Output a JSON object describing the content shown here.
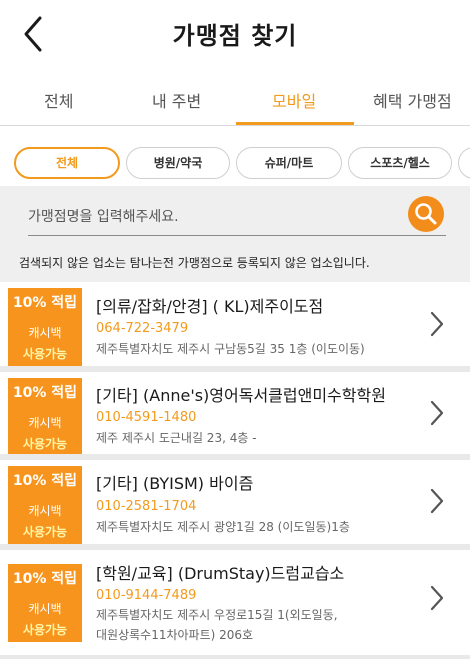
{
  "header": {
    "title": "가맹점 찾기",
    "back_icon": "chevron-left-icon"
  },
  "tabs": [
    {
      "label": "전체",
      "active": false
    },
    {
      "label": "내 주변",
      "active": false
    },
    {
      "label": "모바일",
      "active": true
    },
    {
      "label": "혜택 가맹점",
      "active": false
    }
  ],
  "categories": [
    {
      "label": "전체",
      "active": true
    },
    {
      "label": "병원/약국",
      "active": false
    },
    {
      "label": "슈퍼/마트",
      "active": false
    },
    {
      "label": "스포츠/헬스",
      "active": false
    }
  ],
  "search": {
    "placeholder": "가맹점명을 입력해주세요.",
    "icon": "search-icon"
  },
  "notice": "검색되지 않은 업소는 탐나는전 가맹점으로 등록되지 않은 업소입니다.",
  "stores": [
    {
      "badge_pct": "10% 적립",
      "badge_cash": "캐시백",
      "badge_use": "사용가능",
      "name": "[의류/잡화/안경] ( KL)제주이도점",
      "phone": "064-722-3479",
      "address": [
        "제주특별자치도 제주시 구남동5길 35 1층 (이도이동)"
      ]
    },
    {
      "badge_pct": "10% 적립",
      "badge_cash": "캐시백",
      "badge_use": "사용가능",
      "name": "[기타] (Anne's)영어독서클럽앤미수학학원",
      "phone": "010-4591-1480",
      "address": [
        "제주 제주시  도근내길 23, 4층 -"
      ]
    },
    {
      "badge_pct": "10% 적립",
      "badge_cash": "캐시백",
      "badge_use": "사용가능",
      "name": "[기타] (BYISM) 바이즘",
      "phone": "010-2581-1704",
      "address": [
        "제주특별자치도 제주시 광양1길 28 (이도일동)1층"
      ]
    },
    {
      "badge_pct": "10% 적립",
      "badge_cash": "캐시백",
      "badge_use": "사용가능",
      "name": "[학원/교육] (DrumStay)드럼교습소",
      "phone": "010-9144-7489",
      "address": [
        "제주특별자치도 제주시 우정로15길 1(외도일동,",
        "대원상록수11차아파트) 206호"
      ]
    }
  ],
  "colors": {
    "accent": "#f29a1c",
    "badge": "#f7941e",
    "badge_use_text": "#fff7a8"
  }
}
